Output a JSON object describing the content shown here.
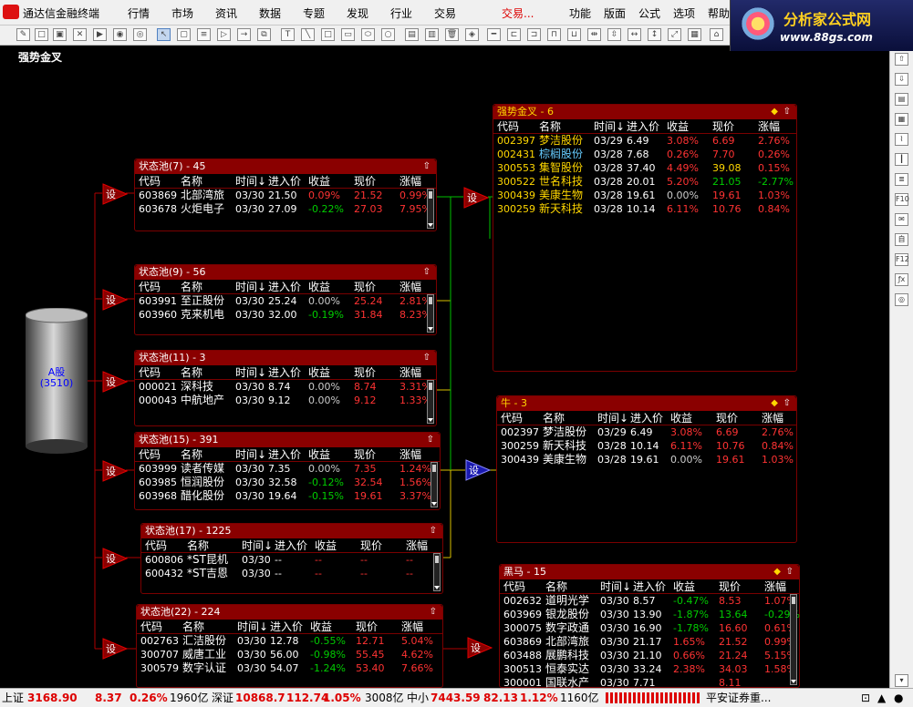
{
  "app": {
    "title": "通达信金融终端"
  },
  "menu": [
    "行情",
    "市场",
    "资讯",
    "数据",
    "专题",
    "发现",
    "行业",
    "交易",
    "交易...",
    "功能",
    "版面",
    "公式",
    "选项",
    "帮助"
  ],
  "brand": {
    "title": "分析家公式网",
    "url": "www.88gs.com"
  },
  "page_title": "强势金叉",
  "cylinder": {
    "label": "A股",
    "count": "(3510)"
  },
  "set_label": "设",
  "headers": [
    "代码",
    "名称",
    "时间↓",
    "进入价",
    "收益",
    "现价",
    "涨幅"
  ],
  "pools": [
    {
      "title": "状态池(7) - 45",
      "rows": [
        [
          "603869",
          "北部湾旅",
          "03/30",
          "21.50",
          "0.09%",
          "21.52",
          "0.99%"
        ],
        [
          "603678",
          "火炬电子",
          "03/30",
          "27.09",
          "-0.22%",
          "27.03",
          "7.95%"
        ]
      ]
    },
    {
      "title": "状态池(9) - 56",
      "rows": [
        [
          "603991",
          "至正股份",
          "03/30",
          "25.24",
          "0.00%",
          "25.24",
          "2.81%"
        ],
        [
          "603960",
          "克来机电",
          "03/30",
          "32.00",
          "-0.19%",
          "31.84",
          "8.23%"
        ]
      ]
    },
    {
      "title": "状态池(11) - 3",
      "rows": [
        [
          "000021",
          "深科技",
          "03/30",
          "8.74",
          "0.00%",
          "8.74",
          "3.31%"
        ],
        [
          "000043",
          "中航地产",
          "03/30",
          "9.12",
          "0.00%",
          "9.12",
          "1.33%"
        ]
      ]
    },
    {
      "title": "状态池(15) - 391",
      "rows": [
        [
          "603999",
          "读者传媒",
          "03/30",
          "7.35",
          "0.00%",
          "7.35",
          "1.24%"
        ],
        [
          "603985",
          "恒润股份",
          "03/30",
          "32.58",
          "-0.12%",
          "32.54",
          "1.56%"
        ],
        [
          "603968",
          "醋化股份",
          "03/30",
          "19.64",
          "-0.15%",
          "19.61",
          "3.37%"
        ]
      ]
    },
    {
      "title": "状态池(17) - 1225",
      "rows": [
        [
          "600806",
          "*ST昆机",
          "03/30",
          "--",
          "--",
          "--",
          "--"
        ],
        [
          "600432",
          "*ST吉恩",
          "03/30",
          "--",
          "--",
          "--",
          "--"
        ]
      ]
    },
    {
      "title": "状态池(22) - 224",
      "rows": [
        [
          "002763",
          "汇洁股份",
          "03/30",
          "12.78",
          "-0.55%",
          "12.71",
          "5.04%"
        ],
        [
          "300707",
          "威唐工业",
          "03/30",
          "56.00",
          "-0.98%",
          "55.45",
          "4.62%"
        ],
        [
          "300579",
          "数字认证",
          "03/30",
          "54.07",
          "-1.24%",
          "53.40",
          "7.66%"
        ]
      ]
    }
  ],
  "results": [
    {
      "title": "强势金叉 - 6",
      "rows": [
        [
          "002397",
          "梦洁股份",
          "03/29",
          "6.49",
          "3.08%",
          "6.69",
          "2.76%"
        ],
        [
          "002431",
          "棕榈股份",
          "03/28",
          "7.68",
          "0.26%",
          "7.70",
          "0.26%"
        ],
        [
          "300553",
          "集智股份",
          "03/28",
          "37.40",
          "4.49%",
          "39.08",
          "0.15%"
        ],
        [
          "300522",
          "世名科技",
          "03/28",
          "20.01",
          "5.20%",
          "21.05",
          "-2.77%"
        ],
        [
          "300439",
          "美康生物",
          "03/28",
          "19.61",
          "0.00%",
          "19.61",
          "1.03%"
        ],
        [
          "300259",
          "新天科技",
          "03/28",
          "10.14",
          "6.11%",
          "10.76",
          "0.84%"
        ]
      ]
    },
    {
      "title": "牛 - 3",
      "rows": [
        [
          "002397",
          "梦洁股份",
          "03/29",
          "6.49",
          "3.08%",
          "6.69",
          "2.76%"
        ],
        [
          "300259",
          "新天科技",
          "03/28",
          "10.14",
          "6.11%",
          "10.76",
          "0.84%"
        ],
        [
          "300439",
          "美康生物",
          "03/28",
          "19.61",
          "0.00%",
          "19.61",
          "1.03%"
        ]
      ]
    },
    {
      "title": "黑马 - 15",
      "rows": [
        [
          "002632",
          "道明光学",
          "03/30",
          "8.57",
          "-0.47%",
          "8.53",
          "1.07%"
        ],
        [
          "603969",
          "银龙股份",
          "03/30",
          "13.90",
          "-1.87%",
          "13.64",
          "-0.29%"
        ],
        [
          "300075",
          "数字政通",
          "03/30",
          "16.90",
          "-1.78%",
          "16.60",
          "0.61%"
        ],
        [
          "603869",
          "北部湾旅",
          "03/30",
          "21.17",
          "1.65%",
          "21.52",
          "0.99%"
        ],
        [
          "603488",
          "展鹏科技",
          "03/30",
          "21.10",
          "0.66%",
          "21.24",
          "5.15%"
        ],
        [
          "300513",
          "恒泰实达",
          "03/30",
          "33.24",
          "2.38%",
          "34.03",
          "1.58%"
        ],
        [
          "300001",
          "国联水产",
          "03/30",
          "7.71",
          "",
          "8.11",
          ""
        ]
      ]
    }
  ],
  "status": {
    "sh_label": "上证",
    "sh_index": "3168.90",
    "sh_chg": "8.37",
    "sh_pct": "0.26%",
    "sh_amt": "1960亿",
    "sz_label": "深证",
    "sz_index": "10868.7",
    "sz_chg": "112.74",
    "sz_pct": "1.05%",
    "sz_amt": "3008亿",
    "zx_label": "中小",
    "zx_index": "7443.59",
    "zx_chg": "82.13",
    "zx_pct": "1.12%",
    "zx_amt": "1160亿",
    "broker": "平安证券重..."
  },
  "colors": {
    "panel_header": "#8a0000",
    "up": "#ff3333",
    "down": "#00cc00",
    "highlight_name": "#66ccff"
  }
}
